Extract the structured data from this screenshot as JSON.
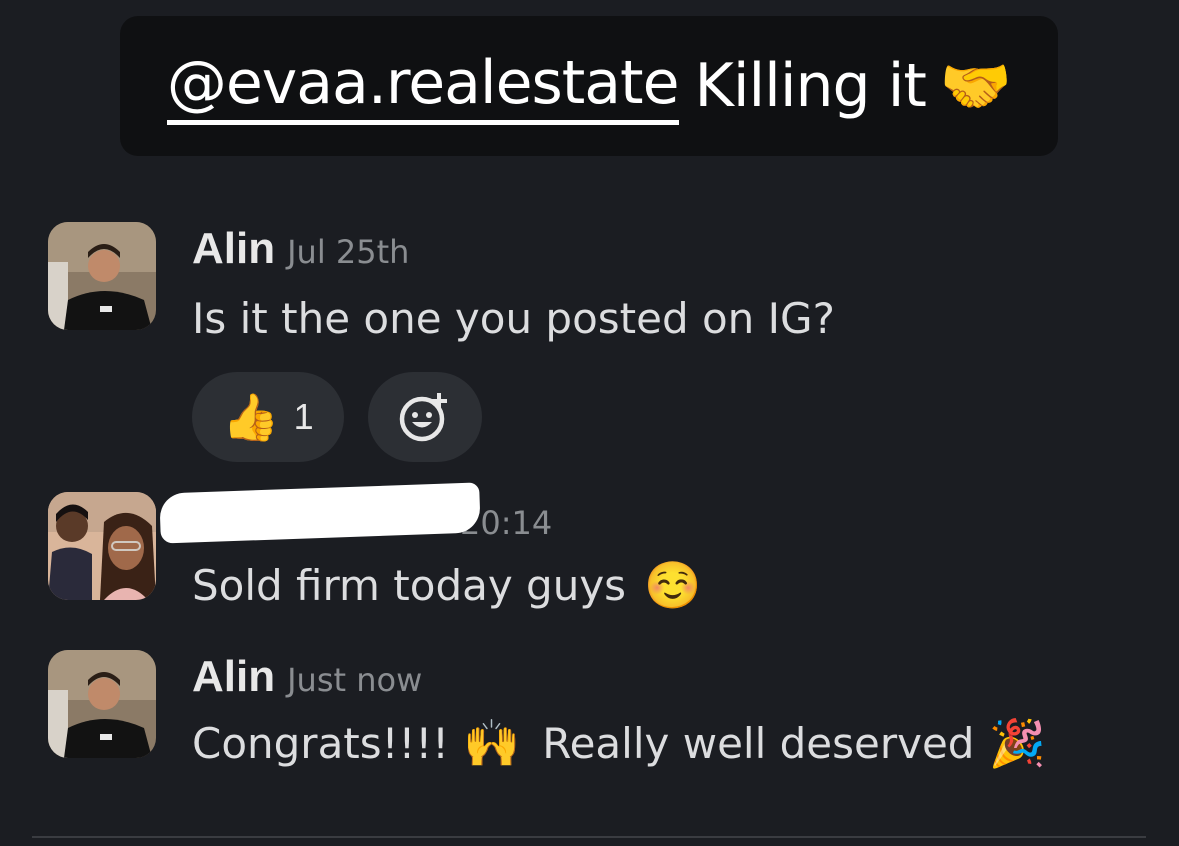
{
  "banner": {
    "mention": "@evaa.realestate",
    "text": "Killing it",
    "emoji": "🤝"
  },
  "messages": [
    {
      "author": "Alin",
      "time": "Jul 25th",
      "text": "Is it the one you posted on IG?",
      "reactions": [
        {
          "emoji": "👍",
          "count": "1"
        }
      ],
      "add_reaction_icon": "add-emoji-icon"
    },
    {
      "author": "",
      "time": "20:14",
      "text": "Sold firm today guys",
      "emoji": "☺️"
    },
    {
      "author": "Alin",
      "time": "Just now",
      "text_part1": "Congrats!!!!",
      "emoji1": "🙌",
      "text_part2": "Really well deserved",
      "emoji2": "🎉"
    }
  ],
  "colors": {
    "background": "#1b1d22",
    "banner_bg": "#0f1012",
    "pill_bg": "#2c2f34"
  }
}
